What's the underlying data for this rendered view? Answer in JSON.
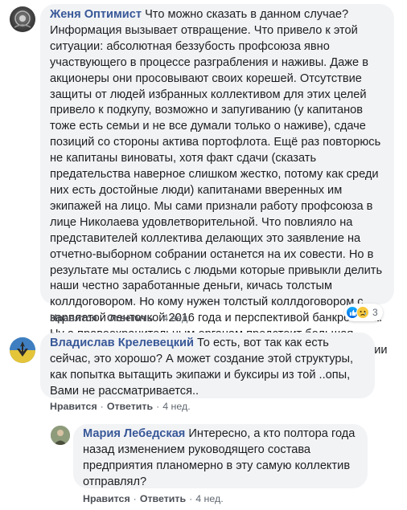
{
  "comments": [
    {
      "author": "Женя Оптимист",
      "text": "Что можно сказать в данном случае? Информация вызывает отвращение. Что привело к этой ситуации: абсолютная беззубость профсоюза явно участвующего в процессе разграбления и наживы. Даже в акционеры они просовывают своих корешей. Отсутствие защиты от людей избранных коллективом для этих целей привело к подкупу, возможно и запугиванию (у капитанов тоже есть семьи и не все думали только о наживе), сдаче позиций со стороны актива портофлота. Ещё раз повторюсь не капитаны виноваты, хотя факт сдачи (сказать предательства наверное слишком жестко, потому как среди них есть достойные люди) капитанами вверенных им экипажей на лицо. Мы сами признали работу профсоюза в лице Николаева удовлетворительной. Что повлияло на представителей коллектива делающих это заявление на отчетно-выборном собрании останется на их совести. Но в результате мы остались с людьми которые привыкли делить наши честно заработанные деньги, кичась толстым коллдоговором. Но кому нужен толстый коллдоговором с зарплатой ленточкой 2016 года и перспективой банкротства. Ну а правоохранительным органам предстоит большая работа по делу о доведении до банкротства, акционировании без участия коллектива и многому другому.",
      "like": "Нравится",
      "reply": "Ответить",
      "time": "4 нед.",
      "reactions": {
        "count": "3",
        "icons": [
          "like-icon",
          "sad-icon"
        ]
      }
    },
    {
      "author": "Владислав Крелевецкий",
      "text": "То есть, вот так как есть сейчас, это хорошо? А может создание этой структуры, как попытка вытащить экипажи и буксиры из той ..опы, Вами не рассматривается..",
      "like": "Нравится",
      "reply": "Ответить",
      "time": "4 нед."
    },
    {
      "author": "Мария Лебедская",
      "text": "Интересно, а кто полтора года назад изменением руководящего состава предприятия планомерно в эту самую коллектив отправлял?",
      "like": "Нравится",
      "reply": "Ответить",
      "time": "4 нед."
    }
  ],
  "separator": "·",
  "colors": {
    "author": "#385898",
    "bubble": "#f2f3f5",
    "like": "#1877f2",
    "sad": "#f7c940"
  }
}
